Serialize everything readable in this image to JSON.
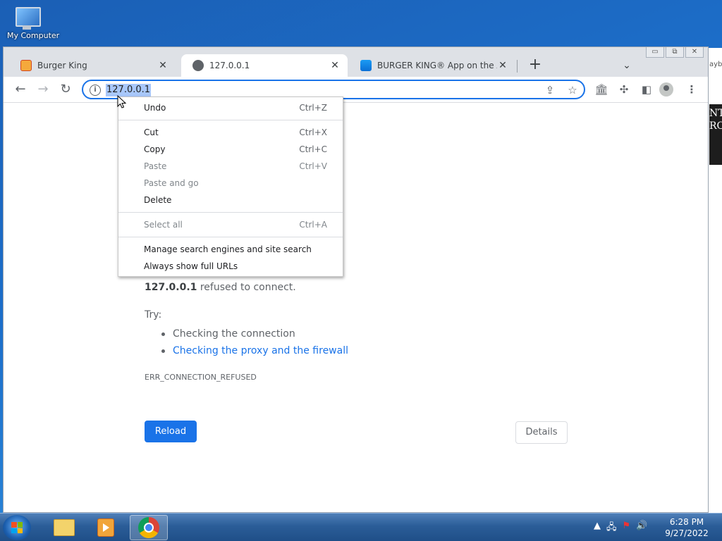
{
  "desktop": {
    "icon_label": "My Computer"
  },
  "background_window": {
    "peek_text": "ayba",
    "dark_text": "NT RO"
  },
  "window_controls": {
    "minimize": "▭",
    "restore": "⧉",
    "close": "✕"
  },
  "tabs": [
    {
      "title": "Burger King",
      "favicon": "burger-king-logo",
      "active": false
    },
    {
      "title": "127.0.0.1",
      "favicon": "globe-icon",
      "active": true
    },
    {
      "title": "BURGER KING® App on the App",
      "favicon": "app-store-icon",
      "active": false
    }
  ],
  "tab_close_glyph": "✕",
  "new_tab_glyph": "+",
  "tab_search_glyph": "⌄",
  "toolbar": {
    "back": "←",
    "forward": "→",
    "reload": "↻",
    "url": "127.0.0.1",
    "info_glyph": "i"
  },
  "context_menu": {
    "items": [
      {
        "label": "Undo",
        "shortcut": "Ctrl+Z",
        "disabled": false
      },
      {
        "label": "Cut",
        "shortcut": "Ctrl+X",
        "disabled": false
      },
      {
        "label": "Copy",
        "shortcut": "Ctrl+C",
        "disabled": false
      },
      {
        "label": "Paste",
        "shortcut": "Ctrl+V",
        "disabled": true
      },
      {
        "label": "Paste and go",
        "shortcut": "",
        "disabled": true
      },
      {
        "label": "Delete",
        "shortcut": "",
        "disabled": false
      },
      {
        "label": "Select all",
        "shortcut": "Ctrl+A",
        "disabled": true
      },
      {
        "label": "Manage search engines and site search",
        "shortcut": "",
        "disabled": false
      },
      {
        "label": "Always show full URLs",
        "shortcut": "",
        "disabled": false
      }
    ]
  },
  "error_page": {
    "host": "127.0.0.1",
    "message": " refused to connect.",
    "try_label": "Try:",
    "suggestions": [
      "Checking the connection",
      "Checking the proxy and the firewall"
    ],
    "code": "ERR_CONNECTION_REFUSED",
    "reload_label": "Reload",
    "details_label": "Details"
  },
  "taskbar": {
    "time": "6:28 PM",
    "date": "9/27/2022",
    "tray_arrow": "▲"
  },
  "colors": {
    "accent": "#1a73e8",
    "selection": "#a8c7fa",
    "tab_strip": "#dee1e6"
  }
}
